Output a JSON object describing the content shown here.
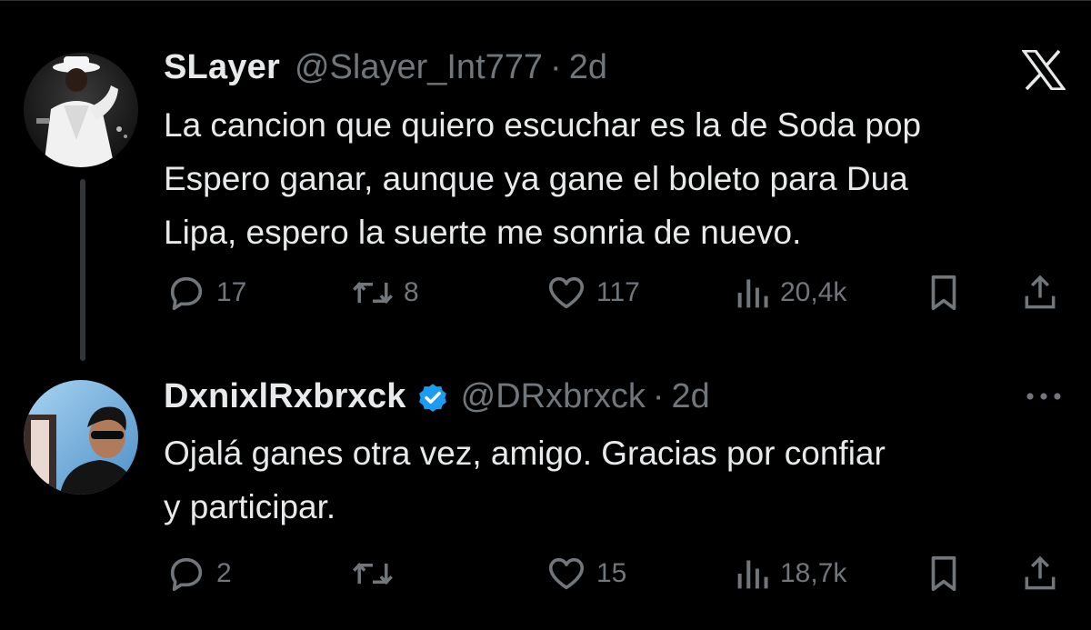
{
  "tweets": [
    {
      "display_name": "SLayer",
      "handle": "@Slayer_Int777",
      "separator": "·",
      "time": "2d",
      "verified": false,
      "body_lines": [
        "La cancion que quiero escuchar es la de Soda pop",
        "Espero ganar, aunque ya gane el boleto para Dua",
        "Lipa, espero la suerte me sonria de nuevo."
      ],
      "actions": {
        "reply": "17",
        "retweet": "8",
        "like": "117",
        "views": "20,4k"
      }
    },
    {
      "display_name": "DxnixlRxbrxck",
      "handle": "@DRxbrxck",
      "separator": "·",
      "time": "2d",
      "verified": true,
      "body_lines": [
        "Ojalá ganes otra vez, amigo. Gracias por confiar",
        "y participar."
      ],
      "actions": {
        "reply": "2",
        "retweet": "",
        "like": "15",
        "views": "18,7k"
      }
    }
  ],
  "icons": {
    "brand": "x-logo-icon",
    "more": "more-options-icon",
    "reply": "reply-icon",
    "retweet": "retweet-icon",
    "like": "heart-icon",
    "views": "views-icon",
    "bookmark": "bookmark-icon",
    "share": "share-icon",
    "verified": "verified-badge-icon"
  },
  "colors": {
    "background": "#000000",
    "text_primary": "#e7e9ea",
    "text_secondary": "#71767b",
    "verified_blue": "#1d9bf0",
    "thread_line": "#333639"
  }
}
